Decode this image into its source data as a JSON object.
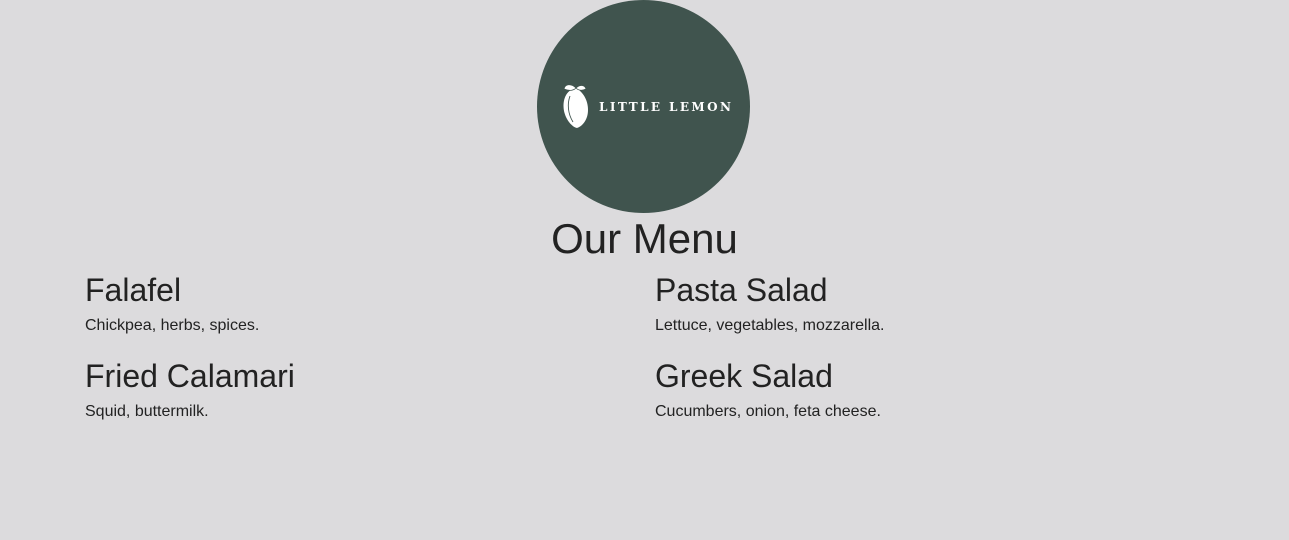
{
  "logo": {
    "brand_text": "LITTLE LEMON",
    "background_color": "#40544e",
    "icon": "lemon-icon"
  },
  "page": {
    "title": "Our Menu",
    "background_color": "#dcdbdd",
    "text_color": "#222222"
  },
  "menu": {
    "items": [
      {
        "name": "Falafel",
        "description": "Chickpea, herbs, spices."
      },
      {
        "name": "Pasta Salad",
        "description": "Lettuce, vegetables, mozzarella."
      },
      {
        "name": "Fried Calamari",
        "description": "Squid, buttermilk."
      },
      {
        "name": "Greek Salad",
        "description": "Cucumbers, onion, feta cheese."
      }
    ]
  }
}
